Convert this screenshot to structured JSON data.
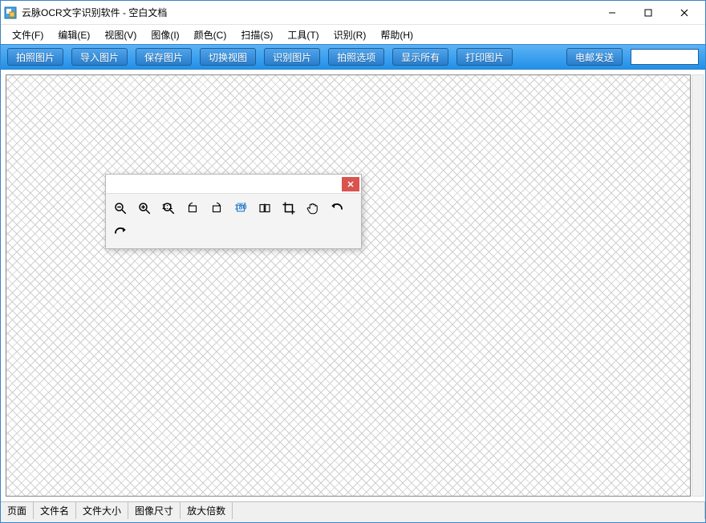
{
  "window": {
    "title": "云脉OCR文字识别软件 - 空白文档"
  },
  "menu": {
    "file": "文件(F)",
    "edit": "编辑(E)",
    "view": "视图(V)",
    "image": "图像(I)",
    "color": "颜色(C)",
    "scan": "扫描(S)",
    "tool": "工具(T)",
    "recognize": "识别(R)",
    "help": "帮助(H)"
  },
  "toolbar": {
    "capture": "拍照图片",
    "import": "导入图片",
    "save": "保存图片",
    "switch_view": "切换视图",
    "recognize_img": "识别图片",
    "capture_options": "拍照选项",
    "show_all": "显示所有",
    "print": "打印图片",
    "email": "电邮发送",
    "search_value": ""
  },
  "float_tools": {
    "zoom_out": "zoom-out",
    "zoom_in": "zoom-in",
    "zoom_1_1": "zoom-1-1",
    "rotate_left": "rotate-left",
    "rotate_right": "rotate-right",
    "rotate_180": "rotate-180",
    "flip": "flip",
    "crop": "crop",
    "pan": "pan",
    "undo": "undo",
    "redo": "redo"
  },
  "statusbar": {
    "page": "页面",
    "filename": "文件名",
    "filesize": "文件大小",
    "image_dim": "图像尺寸",
    "zoom": "放大倍数"
  }
}
